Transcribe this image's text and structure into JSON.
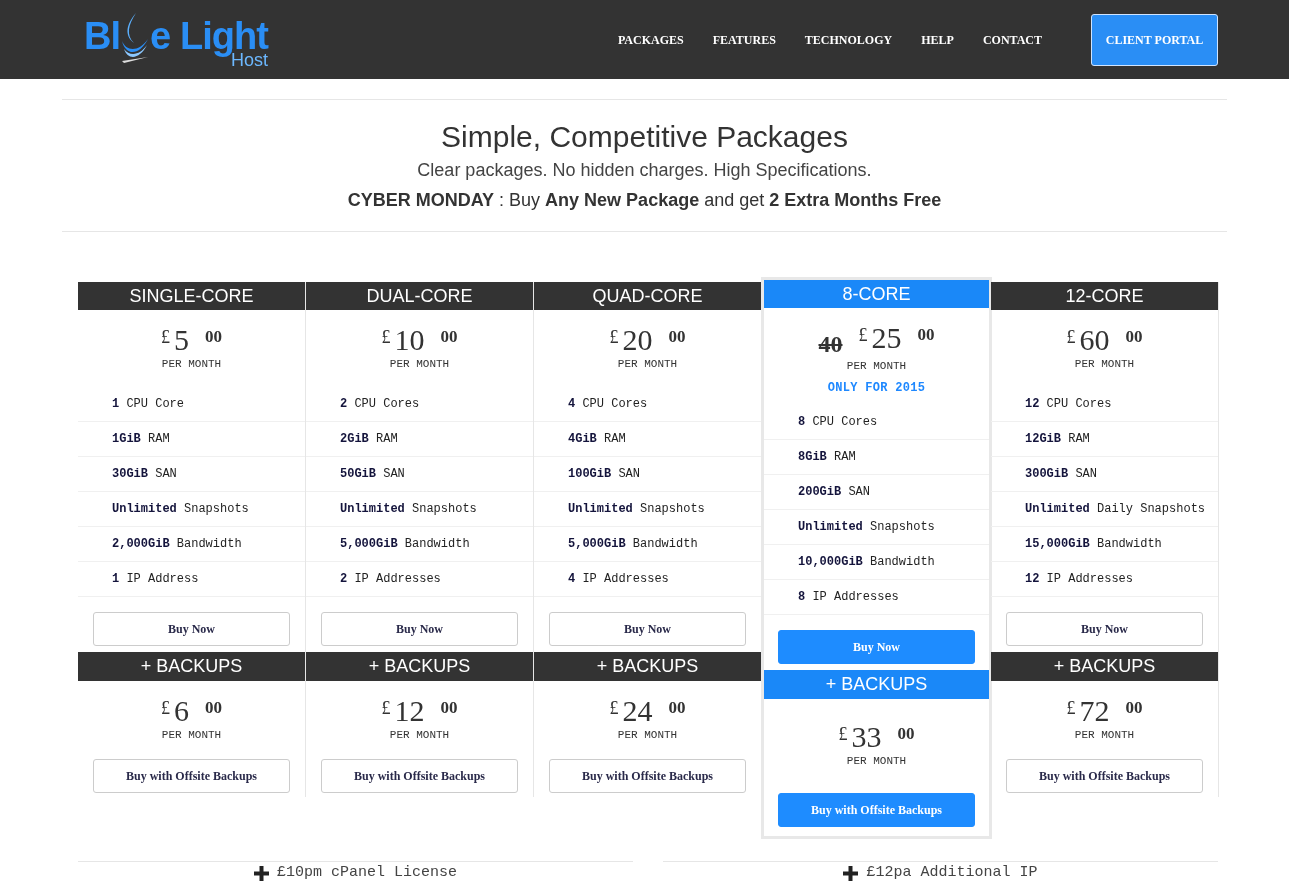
{
  "logo": {
    "text_start": "Bl",
    "text_end": "e Light",
    "subtitle": "Host"
  },
  "nav": [
    {
      "label": "PACKAGES"
    },
    {
      "label": "FEATURES"
    },
    {
      "label": "TECHNOLOGY"
    },
    {
      "label": "HELP"
    },
    {
      "label": "CONTACT"
    }
  ],
  "portal_button": "CLIENT PORTAL",
  "heading": {
    "title": "Simple, Competitive Packages",
    "subtitle": "Clear packages. No hidden charges. High Specifications.",
    "promo": "**CYBER MONDAY** : Buy **Any New Package** and get **2 Extra Months Free**"
  },
  "plans": [
    {
      "name": "SINGLE-CORE",
      "selected": false,
      "currency": "£",
      "amount": "5",
      "cents": "00",
      "period": "PER MONTH",
      "features": [
        "**1** CPU Core",
        "**1GiB** RAM",
        "**30GiB** SAN",
        "**Unlimited** Snapshots",
        "**2,000GiB** Bandwidth",
        "**1** IP Address"
      ],
      "buy": "Buy Now",
      "backups": {
        "title": "+ BACKUPS",
        "currency": "£",
        "amount": "6",
        "cents": "00",
        "period": "PER MONTH",
        "buy": "Buy with Offsite Backups"
      }
    },
    {
      "name": "DUAL-CORE",
      "selected": false,
      "currency": "£",
      "amount": "10",
      "cents": "00",
      "period": "PER MONTH",
      "features": [
        "**2** CPU Cores",
        "**2GiB** RAM",
        "**50GiB** SAN",
        "**Unlimited** Snapshots",
        "**5,000GiB** Bandwidth",
        "**2** IP Addresses"
      ],
      "buy": "Buy Now",
      "backups": {
        "title": "+ BACKUPS",
        "currency": "£",
        "amount": "12",
        "cents": "00",
        "period": "PER MONTH",
        "buy": "Buy with Offsite Backups"
      }
    },
    {
      "name": "QUAD-CORE",
      "selected": false,
      "currency": "£",
      "amount": "20",
      "cents": "00",
      "period": "PER MONTH",
      "features": [
        "**4** CPU Cores",
        "**4GiB** RAM",
        "**100GiB** SAN",
        "**Unlimited** Snapshots",
        "**5,000GiB** Bandwidth",
        "**4** IP Addresses"
      ],
      "buy": "Buy Now",
      "backups": {
        "title": "+ BACKUPS",
        "currency": "£",
        "amount": "24",
        "cents": "00",
        "period": "PER MONTH",
        "buy": "Buy with Offsite Backups"
      }
    },
    {
      "name": "8-CORE",
      "selected": true,
      "old_price": "40",
      "currency": "£",
      "amount": "25",
      "cents": "00",
      "period": "PER MONTH",
      "note": "ONLY FOR 2015",
      "features": [
        "**8** CPU Cores",
        "**8GiB** RAM",
        "**200GiB** SAN",
        "**Unlimited** Snapshots",
        "**10,000GiB** Bandwidth",
        "**8** IP Addresses"
      ],
      "buy": "Buy Now",
      "backups": {
        "title": "+ BACKUPS",
        "currency": "£",
        "amount": "33",
        "cents": "00",
        "period": "PER MONTH",
        "buy": "Buy with Offsite Backups"
      }
    },
    {
      "name": "12-CORE",
      "selected": false,
      "currency": "£",
      "amount": "60",
      "cents": "00",
      "period": "PER MONTH",
      "features": [
        "**12** CPU Cores",
        "**12GiB** RAM",
        "**300GiB** SAN",
        "**Unlimited** Daily Snapshots",
        "**15,000GiB** Bandwidth",
        "**12** IP Addresses"
      ],
      "buy": "Buy Now",
      "backups": {
        "title": "+ BACKUPS",
        "currency": "£",
        "amount": "72",
        "cents": "00",
        "period": "PER MONTH",
        "buy": "Buy with Offsite Backups"
      }
    }
  ],
  "addons": [
    {
      "label": "£10pm cPanel License"
    },
    {
      "label": "£12pa Additional IP"
    }
  ]
}
